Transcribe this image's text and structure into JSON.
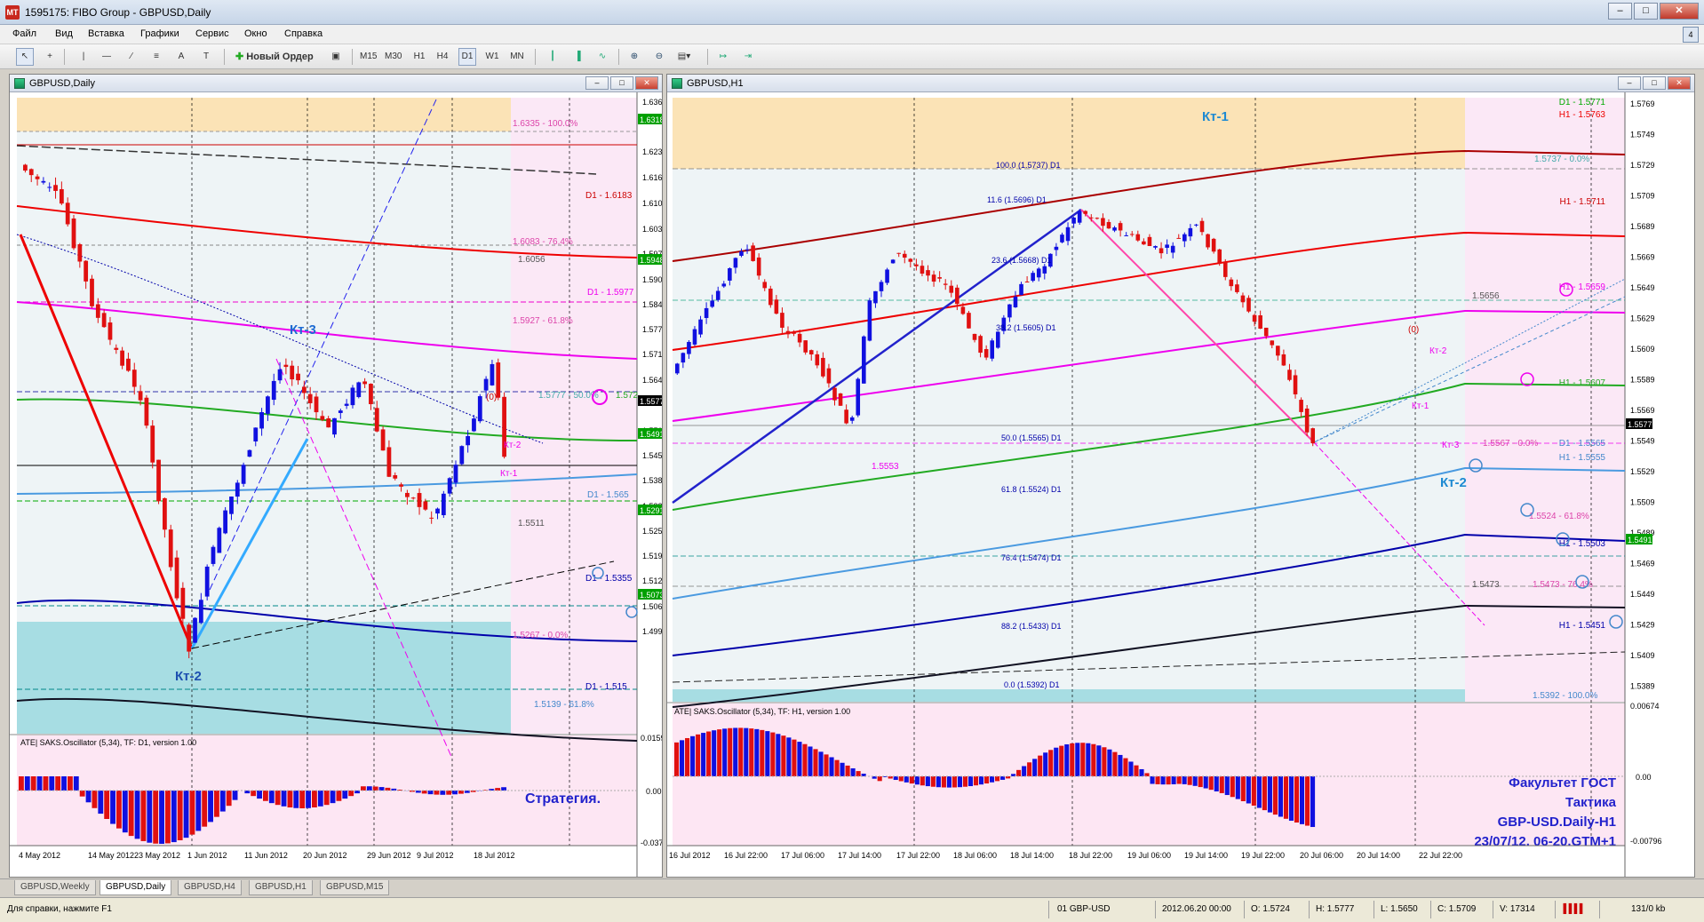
{
  "window": {
    "title": "1595175: FIBO Group - GBPUSD,Daily",
    "icon": "mt4-icon",
    "min": "–",
    "max": "□",
    "close": "✕"
  },
  "menu": [
    "Файл",
    "Вид",
    "Вставка",
    "Графики",
    "Сервис",
    "Окно",
    "Справка"
  ],
  "toolbar": {
    "new_order": "Новый Ордер",
    "timeframes": [
      "M15",
      "M30",
      "H1",
      "H4",
      "D1",
      "W1",
      "MN"
    ],
    "active_tf": "D1",
    "tools": [
      "cursor-icon",
      "crosshair-icon",
      "vertical-line-icon",
      "horizontal-line-icon",
      "trendline-icon",
      "channel-icon",
      "text-icon",
      "label-icon"
    ]
  },
  "daily": {
    "title": "GBPUSD,Daily",
    "price_ticks": [
      "1.6362",
      "1.6232",
      "1.6167",
      "1.6102",
      "1.6037",
      "1.5972",
      "1.5907",
      "1.5842",
      "1.5777",
      "1.5712",
      "1.5647",
      "1.5517",
      "1.5452",
      "1.5387",
      "1.5322",
      "1.5257",
      "1.5192",
      "1.5127",
      "1.5062",
      "1.4997"
    ],
    "price_tags": [
      {
        "v": "1.6318",
        "c": "#00a000"
      },
      {
        "v": "1.5948",
        "c": "#00a000"
      },
      {
        "v": "1.5577",
        "c": "#000000"
      },
      {
        "v": "1.5491",
        "c": "#00a000"
      },
      {
        "v": "1.5291",
        "c": "#00a000"
      },
      {
        "v": "1.5073",
        "c": "#00a000"
      }
    ],
    "fib_labels": [
      "1.6335 - 100.0%",
      "1.6083 - 76.4%",
      "1.5927 - 61.8%",
      "1.5777 - 50.0%",
      "1.5267 - 0.0%",
      "1.5139 - 61.8%"
    ],
    "level_labels": [
      "D1 - 1.6183",
      "D1 - 1.5977",
      "D1 - 1.565",
      "D1 - 1.5355",
      "D1 - 1.515",
      "1.6056",
      "1.5511",
      "1.572"
    ],
    "wave_labels": [
      "Кт-3",
      "Кт-2",
      "Кт-2",
      "Кт-1",
      "(0)"
    ],
    "osc_title": "ATE| SAKS.Oscillator (5,34), TF: D1, version 1.00",
    "osc_ticks": [
      "0.01593",
      "0.00",
      "-0.03732"
    ],
    "strategy": "Стратегия.",
    "dates": [
      "4 May 2012",
      "14 May 2012",
      "23 May 2012",
      "1 Jun 2012",
      "11 Jun 2012",
      "20 Jun 2012",
      "29 Jun 2012",
      "9 Jul 2012",
      "18 Jul 2012"
    ]
  },
  "h1": {
    "title": "GBPUSD,H1",
    "price_ticks": [
      "1.5769",
      "1.5749",
      "1.5729",
      "1.5709",
      "1.5689",
      "1.5669",
      "1.5649",
      "1.5629",
      "1.5609",
      "1.5589",
      "1.5569",
      "1.5549",
      "1.5529",
      "1.5509",
      "1.5489",
      "1.5469",
      "1.5449",
      "1.5429",
      "1.5409",
      "1.5389"
    ],
    "price_tags": [
      {
        "v": "1.5577",
        "c": "#000000"
      },
      {
        "v": "1.5491",
        "c": "#00a000"
      }
    ],
    "fib_labels": [
      "100.0 (1.5737) D1",
      "11.6 (1.5696) D1",
      "23.6 (1.5668) D1",
      "38.2 (1.5605) D1",
      "50.0 (1.5565) D1",
      "61.8 (1.5524) D1",
      "76.4 (1.5474) D1",
      "88.2 (1.5433) D1",
      "0.0 (1.5392) D1"
    ],
    "right_labels": [
      "D1 - 1.5771",
      "H1 - 1.5763",
      "1.5737 - 0.0%",
      "H1 - 1.5711",
      "H1 - 1.5659",
      "1.5656",
      "H1 - 1.5607",
      "1.5567 - 0.0%",
      "D1 - 1.5565",
      "H1 - 1.5555",
      "1.5524 - 61.8%",
      "H1 - 1.5503",
      "1.5473",
      "1.5473 - 76.4%",
      "H1 - 1.5451",
      "1.5392 - 100.0%",
      "1.5553"
    ],
    "wave_labels": [
      "Кт-1",
      "Кт-2",
      "Кт-2",
      "Кт-1",
      "Кт-3",
      "(0)"
    ],
    "osc_title": "ATE| SAKS.Oscillator (5,34), TF: H1, version 1.00",
    "osc_ticks": [
      "0.00674",
      "0.00",
      "-0.00796"
    ],
    "caption": [
      "Факультет ГОСТ",
      "Тактика",
      "GBP-USD.Daily-H1",
      "23/07/12. 06-20.GTM+1"
    ],
    "dates": [
      "16 Jul 2012",
      "16 Jul 22:00",
      "17 Jul 06:00",
      "17 Jul 14:00",
      "17 Jul 22:00",
      "18 Jul 06:00",
      "18 Jul 14:00",
      "18 Jul 22:00",
      "19 Jul 06:00",
      "19 Jul 14:00",
      "19 Jul 22:00",
      "20 Jul 06:00",
      "20 Jul 14:00",
      "22 Jul 22:00"
    ]
  },
  "tabs": [
    "GBPUSD,Weekly",
    "GBPUSD,Daily",
    "GBPUSD,H4",
    "GBPUSD,H1",
    "GBPUSD,M15"
  ],
  "active_tab": "GBPUSD,Daily",
  "status": {
    "help": "Для справки, нажмите F1",
    "profile": "01 GBP-USD",
    "datetime": "2012.06.20 00:00",
    "open": "O: 1.5724",
    "high": "H: 1.5777",
    "low": "L: 1.5650",
    "close": "C: 1.5709",
    "volume": "V: 17314",
    "traffic": "131/0 kb"
  }
}
